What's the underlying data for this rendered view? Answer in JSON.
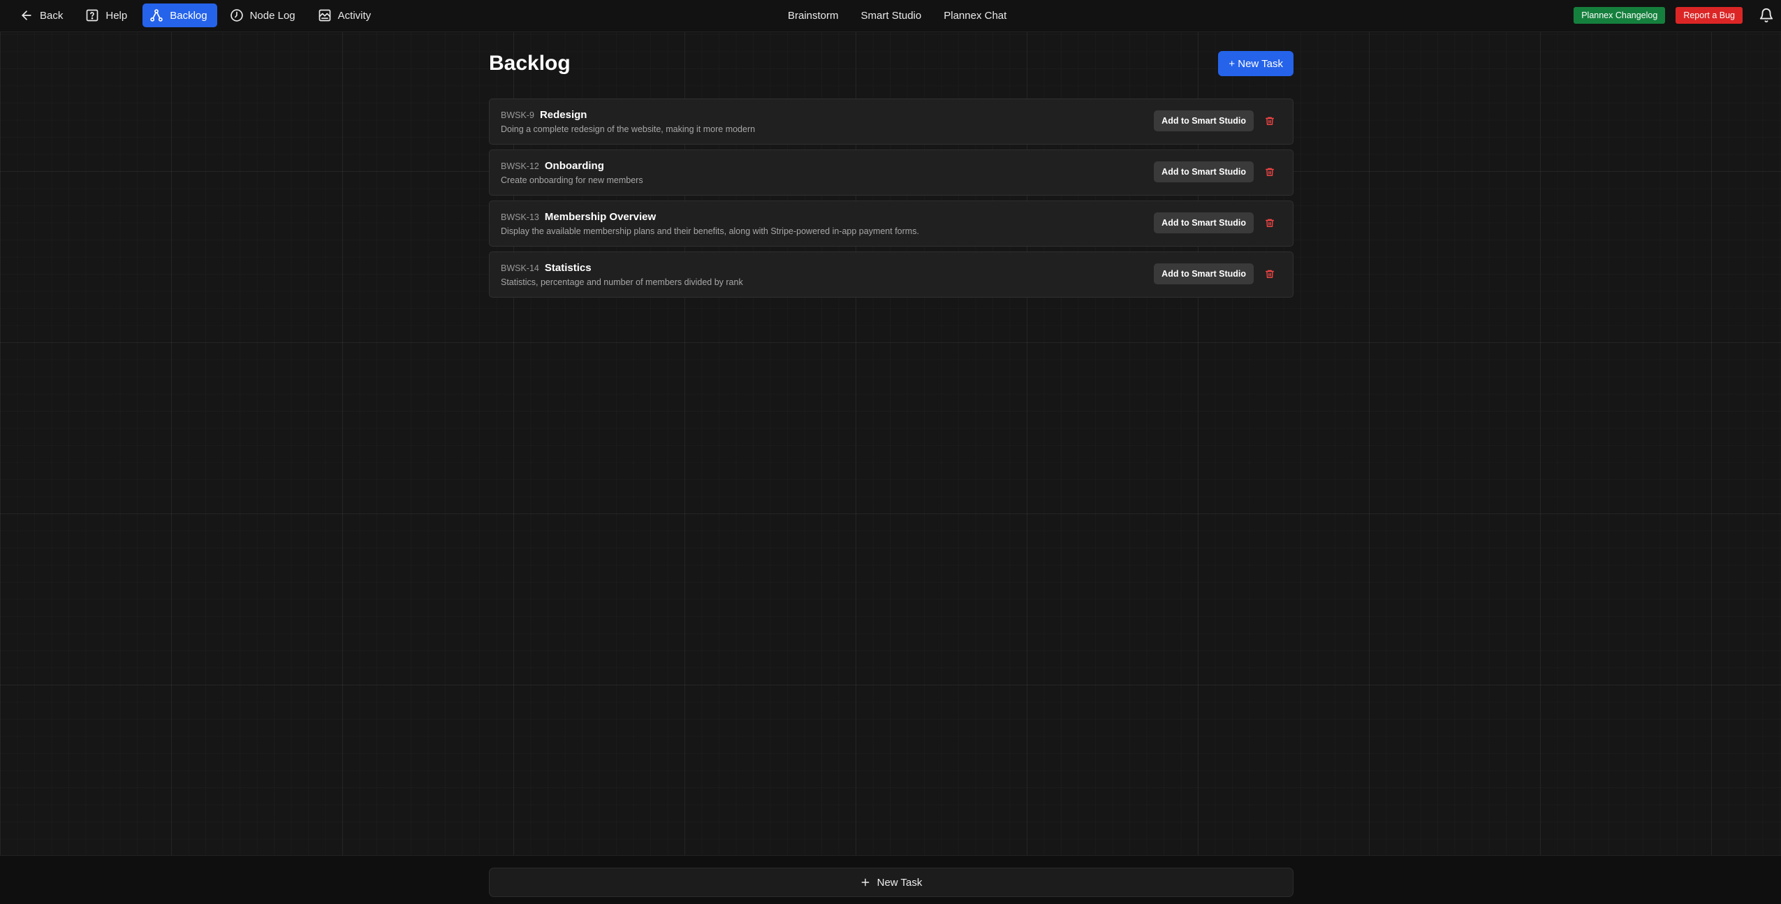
{
  "nav": {
    "left": [
      {
        "label": "Back",
        "icon": "arrow-left-icon",
        "active": false
      },
      {
        "label": "Help",
        "icon": "help-icon",
        "active": false
      },
      {
        "label": "Backlog",
        "icon": "backlog-icon",
        "active": true
      },
      {
        "label": "Node Log",
        "icon": "clock-icon",
        "active": false
      },
      {
        "label": "Activity",
        "icon": "activity-icon",
        "active": false
      }
    ],
    "center": [
      "Brainstorm",
      "Smart Studio",
      "Plannex Chat"
    ],
    "changelog_label": "Plannex Changelog",
    "bug_label": "Report a Bug",
    "bell_icon": "bell-icon"
  },
  "page": {
    "title": "Backlog",
    "new_task_label": "+ New Task"
  },
  "tasks": [
    {
      "id": "BWSK-9",
      "title": "Redesign",
      "description": "Doing a complete redesign of the website, making it more modern",
      "action_label": "Add to Smart Studio"
    },
    {
      "id": "BWSK-12",
      "title": "Onboarding",
      "description": "Create onboarding for new members",
      "action_label": "Add to Smart Studio"
    },
    {
      "id": "BWSK-13",
      "title": "Membership Overview",
      "description": "Display the available membership plans and their benefits, along with Stripe-powered in-app payment forms.",
      "action_label": "Add to Smart Studio"
    },
    {
      "id": "BWSK-14",
      "title": "Statistics",
      "description": "Statistics, percentage and number of members divided by rank",
      "action_label": "Add to Smart Studio"
    }
  ],
  "bottom": {
    "new_task_label": "New Task"
  },
  "colors": {
    "accent": "#2563eb",
    "changelog": "#15803d",
    "bug": "#dc2626",
    "trash": "#ef4444"
  }
}
